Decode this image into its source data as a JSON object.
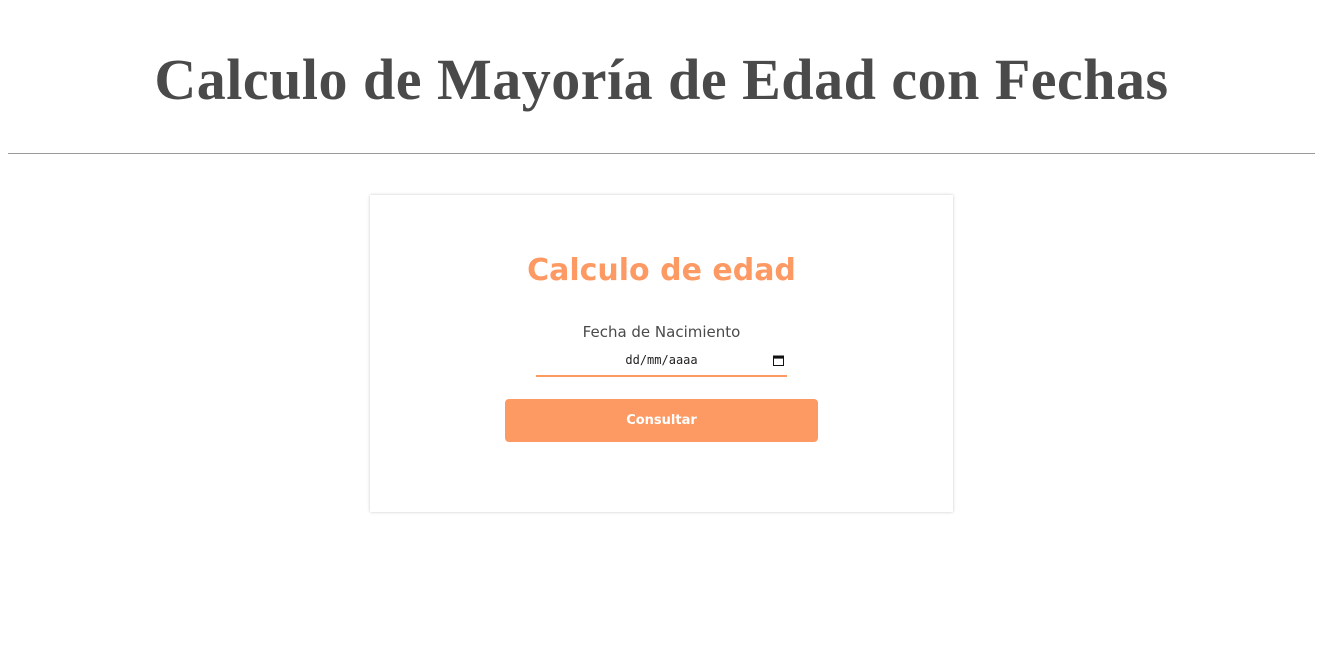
{
  "header": {
    "title": "Calculo de Mayoría de Edad con Fechas"
  },
  "form": {
    "title": "Calculo de edad",
    "birthdate": {
      "label": "Fecha de Nacimiento",
      "placeholder": "dd/mm/aaaa",
      "icon": "calendar-icon"
    },
    "submit_label": "Consultar"
  },
  "colors": {
    "accent": "#fd9a64",
    "heading": "#4a4a4a",
    "divider": "#9a9a9a"
  }
}
